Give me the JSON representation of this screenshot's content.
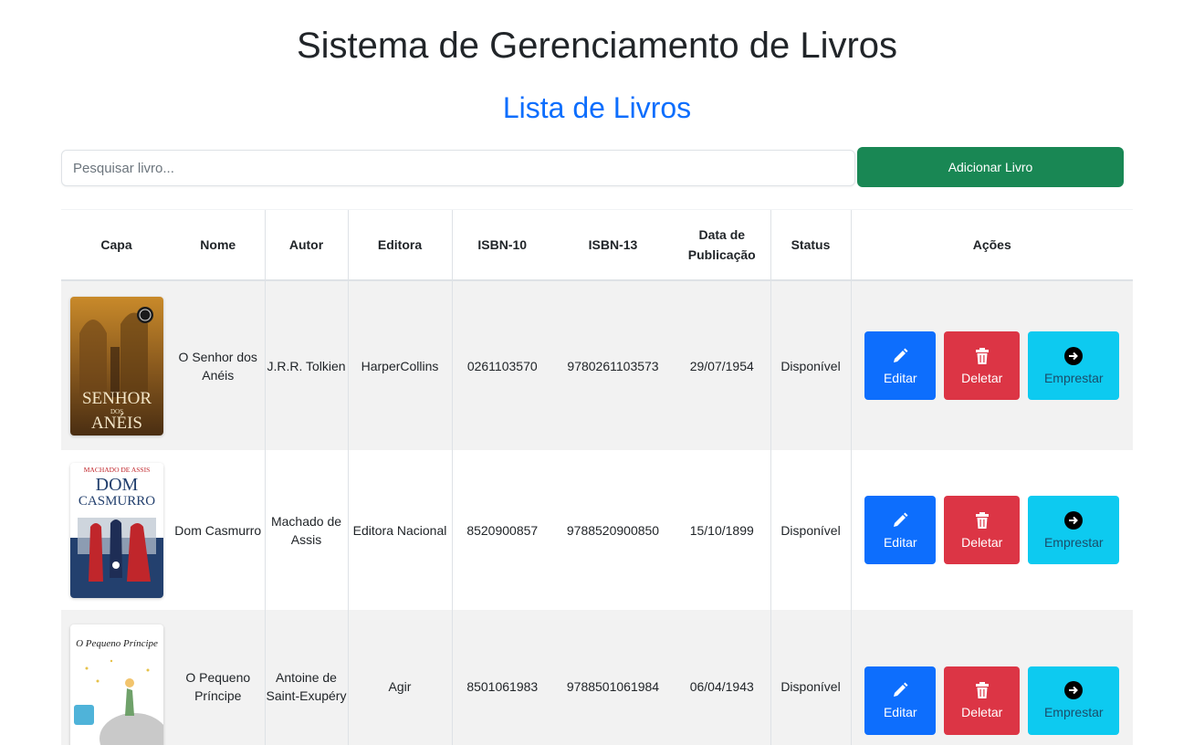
{
  "header": {
    "title": "Sistema de Gerenciamento de Livros",
    "subtitle": "Lista de Livros"
  },
  "toolbar": {
    "search_placeholder": "Pesquisar livro...",
    "add_label": "Adicionar Livro"
  },
  "table": {
    "columns": [
      "Capa",
      "Nome",
      "Autor",
      "Editora",
      "ISBN-10",
      "ISBN-13",
      "Data de Publicação",
      "Status",
      "Ações"
    ],
    "rows": [
      {
        "name": "O Senhor dos Anéis",
        "author": "J.R.R. Tolkien",
        "publisher": "HarperCollins",
        "isbn10": "0261103570",
        "isbn13": "9780261103573",
        "date": "29/07/1954",
        "status": "Disponível",
        "cover_text": [
          "SENHOR",
          "DOS",
          "ANÉIS"
        ]
      },
      {
        "name": "Dom Casmurro",
        "author": "Machado de Assis",
        "publisher": "Editora Nacional",
        "isbn10": "8520900857",
        "isbn13": "9788520900850",
        "date": "15/10/1899",
        "status": "Disponível",
        "cover_text": [
          "MACHADO DE ASSIS",
          "DOM",
          "CASMURRO"
        ]
      },
      {
        "name": "O Pequeno Príncipe",
        "author": "Antoine de Saint-Exupéry",
        "publisher": "Agir",
        "isbn10": "8501061983",
        "isbn13": "9788501061984",
        "date": "06/04/1943",
        "status": "Disponível",
        "cover_text": [
          "O Pequeno Príncipe"
        ]
      }
    ],
    "actions": {
      "edit_label": "Editar",
      "delete_label": "Deletar",
      "lend_label": "Emprestar"
    }
  },
  "colors": {
    "primary": "#0d6efd",
    "success": "#198754",
    "danger": "#dc3545",
    "info": "#0dcaf0"
  },
  "icons": {
    "edit": "pencil-icon",
    "delete": "trash-icon",
    "lend": "arrow-circle-right-icon"
  }
}
